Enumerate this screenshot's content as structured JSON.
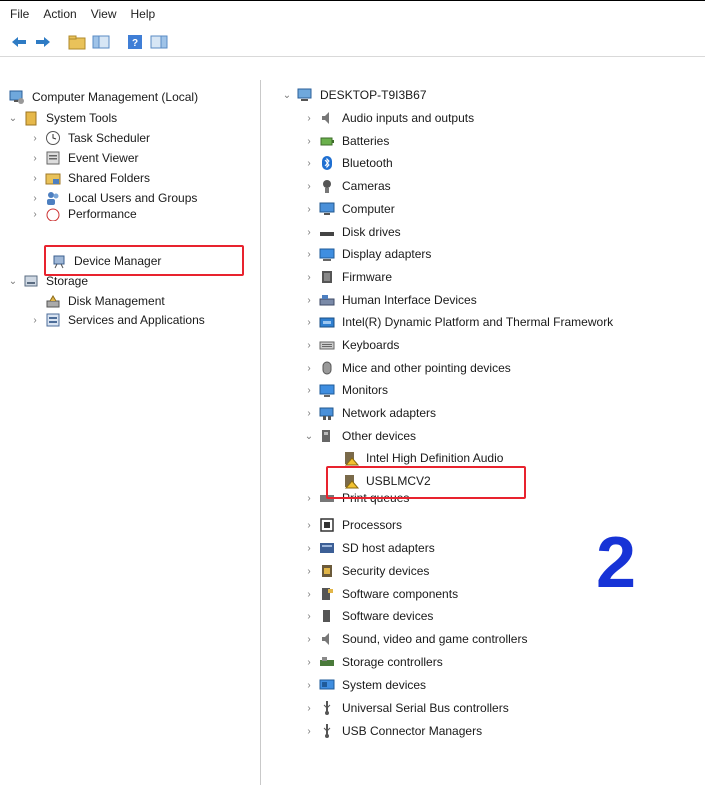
{
  "menu": [
    "File",
    "Action",
    "View",
    "Help"
  ],
  "left_tree": {
    "root": "Computer Management (Local)",
    "system_tools": "System Tools",
    "task_scheduler": "Task Scheduler",
    "event_viewer": "Event Viewer",
    "shared_folders": "Shared Folders",
    "local_users": "Local Users and Groups",
    "performance": "Performance",
    "device_manager": "Device Manager",
    "storage": "Storage",
    "disk_management": "Disk Management",
    "services": "Services and Applications"
  },
  "device_tree": {
    "computer": "DESKTOP-T9I3B67",
    "audio": "Audio inputs and outputs",
    "batteries": "Batteries",
    "bluetooth": "Bluetooth",
    "cameras": "Cameras",
    "computer_node": "Computer",
    "disk_drives": "Disk drives",
    "display_adapters": "Display adapters",
    "firmware": "Firmware",
    "hid": "Human Interface Devices",
    "intel_dptf": "Intel(R) Dynamic Platform and Thermal Framework",
    "keyboards": "Keyboards",
    "mice": "Mice and other pointing devices",
    "monitors": "Monitors",
    "network": "Network adapters",
    "other_devices": "Other devices",
    "intel_hd_audio": "Intel High Definition Audio",
    "usb_device": "USBLMCV2",
    "print_queues": "Print queues",
    "processors": "Processors",
    "sd_host": "SD host adapters",
    "security": "Security devices",
    "software_components": "Software components",
    "software_devices": "Software devices",
    "sound": "Sound, video and game controllers",
    "storage_ctrl": "Storage controllers",
    "system_devices": "System devices",
    "usb_controllers": "Universal Serial Bus controllers",
    "usb_connector": "USB Connector Managers"
  },
  "annotation_step": "2",
  "colors": {
    "highlight_box": "#e8232e",
    "step_number": "#1733d6"
  }
}
